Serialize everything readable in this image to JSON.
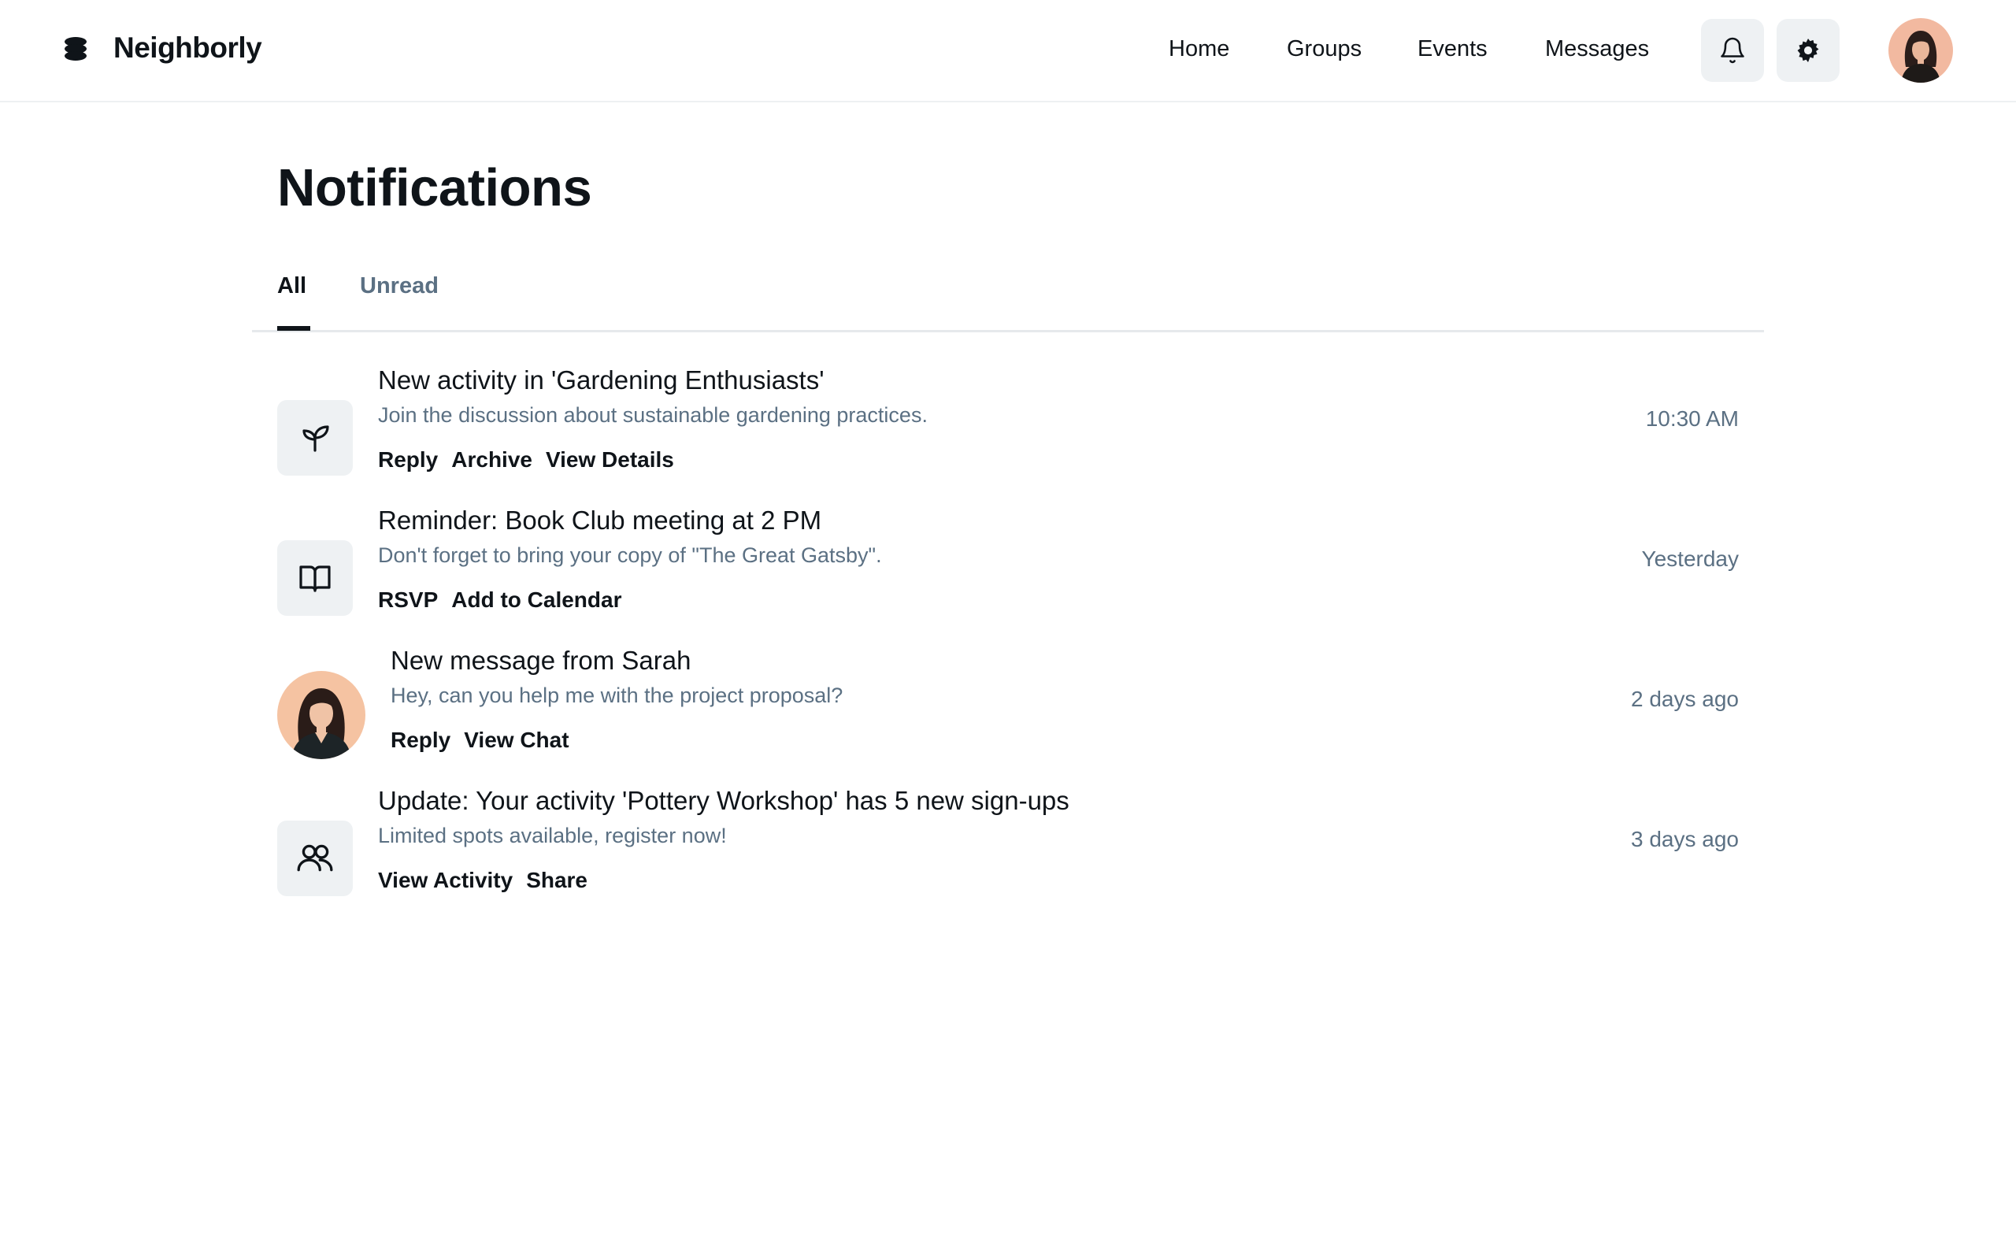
{
  "header": {
    "brand": "Neighborly",
    "nav": [
      "Home",
      "Groups",
      "Events",
      "Messages"
    ],
    "icons": [
      "logo-icon",
      "bell-icon",
      "settings-icon",
      "user-avatar"
    ]
  },
  "page": {
    "title": "Notifications",
    "tabs": [
      "All",
      "Unread"
    ],
    "active_tab": "All"
  },
  "notifications": [
    {
      "icon": "sprout-icon",
      "title": "New activity in 'Gardening Enthusiasts'",
      "desc": "Join the discussion about sustainable gardening practices.",
      "actions": [
        "Reply",
        "Archive",
        "View Details"
      ],
      "time": "10:30 AM"
    },
    {
      "icon": "book-icon",
      "title": "Reminder: Book Club meeting at 2 PM",
      "desc": "Don't forget to bring your copy of \"The Great Gatsby\".",
      "actions": [
        "RSVP",
        "Add to Calendar"
      ],
      "time": "Yesterday"
    },
    {
      "icon": "avatar-sarah",
      "title": "New message from Sarah",
      "desc": "Hey, can you help me with the project proposal?",
      "actions": [
        "Reply",
        "View Chat"
      ],
      "time": "2 days ago"
    },
    {
      "icon": "users-icon",
      "title": "Update: Your activity 'Pottery Workshop' has 5 new sign-ups",
      "desc": "Limited spots available, register now!",
      "actions": [
        "View Activity",
        "Share"
      ],
      "time": "3 days ago"
    }
  ],
  "colors": {
    "text": "#0f1419",
    "muted": "#5b7083",
    "icon_bg": "#eef1f3",
    "avatar_bg": "#f2b9a0"
  }
}
